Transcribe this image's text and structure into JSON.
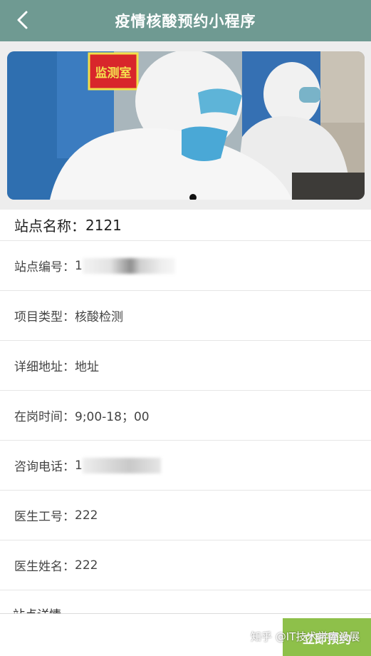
{
  "header": {
    "title": "疫情核酸预约小程序",
    "back_icon": "chevron-left-icon"
  },
  "banner": {
    "sign_text": "监测室",
    "indicator_count": 1
  },
  "station": {
    "name_label": "站点名称：",
    "name_value": "2121"
  },
  "fields": [
    {
      "label": "站点编号：",
      "value": "1"
    },
    {
      "label": "项目类型：",
      "value": "核酸检测"
    },
    {
      "label": "详细地址：",
      "value": "地址"
    },
    {
      "label": "在岗时间：",
      "value": "9;00-18；00"
    },
    {
      "label": "咨询电话：",
      "value": "1"
    },
    {
      "label": "医生工号：",
      "value": "222"
    },
    {
      "label": "医生姓名：",
      "value": "222"
    }
  ],
  "detail_label": "站点详情",
  "bottom_bar": {
    "submit_label": "立即预约"
  },
  "watermark": "知乎 @IT技术学库设展",
  "colors": {
    "header_bg": "#6f9a92",
    "button_bg": "#8ec04a"
  }
}
